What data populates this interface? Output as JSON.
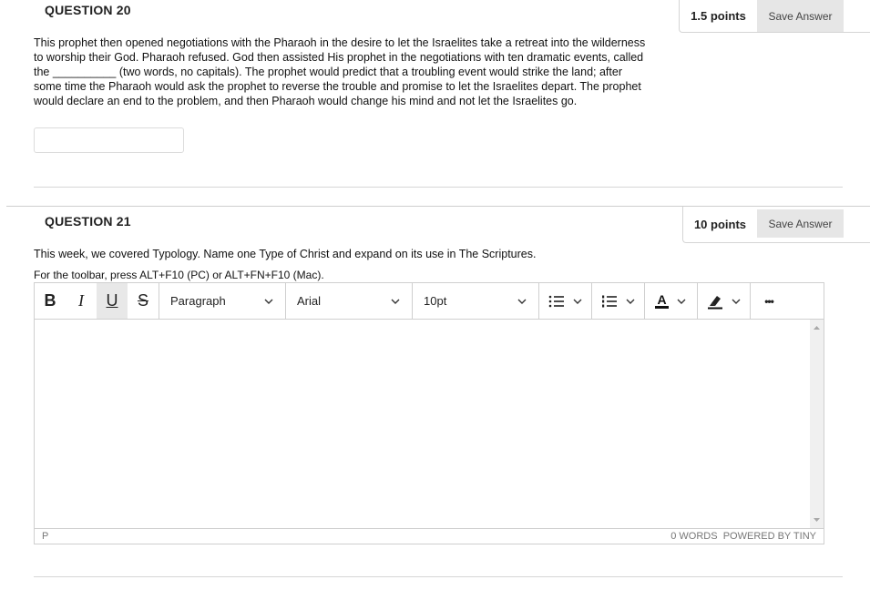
{
  "q20": {
    "title": "QUESTION 20",
    "points": "1.5 points",
    "save_label": "Save Answer",
    "text": "This prophet then opened negotiations with the Pharaoh in the desire to let the Israelites take a retreat into the wilderness to worship their God. Pharaoh refused. God then assisted His prophet in the negotiations with ten dramatic events, called the __________ (two words, no capitals). The prophet would predict that a troubling event would strike the land; after some time the Pharaoh would ask the prophet to reverse the trouble and promise to let the Israelites depart. The prophet would declare an end to the problem, and then Pharaoh would change his mind and not let the Israelites go.",
    "answer_value": ""
  },
  "q21": {
    "title": "QUESTION 21",
    "points": "10 points",
    "save_label": "Save Answer",
    "text": "This week, we covered Typology. Name one Type of Christ and expand on its use in The Scriptures.",
    "toolbar_hint": "For the toolbar, press ALT+F10 (PC) or ALT+FN+F10 (Mac)."
  },
  "editor": {
    "bold": "B",
    "italic": "I",
    "underline": "U",
    "strike": "S",
    "block_format": "Paragraph",
    "font_family": "Arial",
    "font_size": "10pt",
    "text_color_glyph": "A",
    "more_glyph": "•••",
    "status_path": "P",
    "word_count": "0 WORDS",
    "powered_by": "POWERED BY TINY"
  }
}
